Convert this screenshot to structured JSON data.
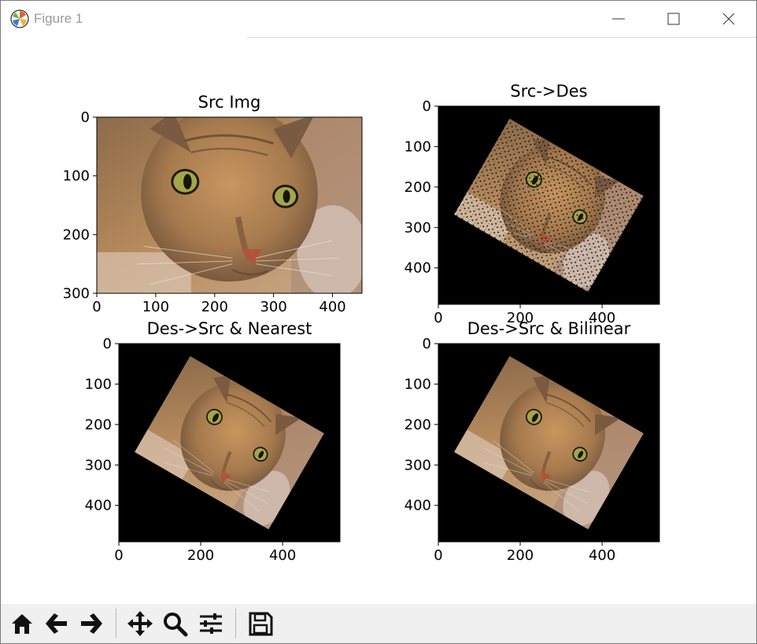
{
  "window": {
    "title": "Figure 1"
  },
  "chart_data": [
    {
      "type": "image",
      "title": "Src Img",
      "xticks": [
        "0",
        "100",
        "200",
        "300",
        "400"
      ],
      "yticks": [
        "0",
        "100",
        "200",
        "300"
      ],
      "xlim": [
        0,
        450
      ],
      "ylim": [
        300,
        0
      ]
    },
    {
      "type": "image",
      "title": "Src->Des",
      "xticks": [
        "0",
        "200",
        "400"
      ],
      "yticks": [
        "0",
        "100",
        "200",
        "300",
        "400"
      ],
      "xlim": [
        0,
        540
      ],
      "ylim": [
        490,
        0
      ]
    },
    {
      "type": "image",
      "title": "Des->Src & Nearest",
      "xticks": [
        "0",
        "200",
        "400"
      ],
      "yticks": [
        "0",
        "100",
        "200",
        "300",
        "400"
      ],
      "xlim": [
        0,
        540
      ],
      "ylim": [
        490,
        0
      ]
    },
    {
      "type": "image",
      "title": "Des->Src & Bilinear",
      "xticks": [
        "0",
        "200",
        "400"
      ],
      "yticks": [
        "0",
        "100",
        "200",
        "300",
        "400"
      ],
      "xlim": [
        0,
        540
      ],
      "ylim": [
        490,
        0
      ]
    }
  ],
  "toolbar": {
    "tools": [
      "home-icon",
      "back-arrow-icon",
      "forward-arrow-icon",
      "pan-icon",
      "zoom-icon",
      "subplots-icon",
      "save-icon"
    ]
  }
}
